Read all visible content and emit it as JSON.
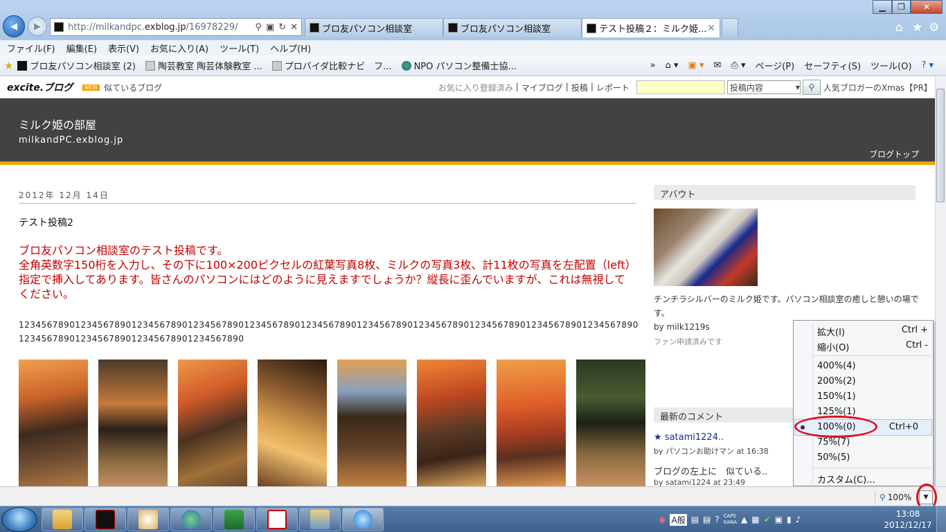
{
  "browser": {
    "address": {
      "prefix": "http://milkandpc.",
      "host": "exblog.jp",
      "path": "/16978229/"
    },
    "tabs": [
      {
        "label": "ブロ友パソコン相談室"
      },
      {
        "label": "ブロ友パソコン相談室"
      },
      {
        "label": "テスト投稿２：ミルク姫..."
      }
    ],
    "menu": [
      "ファイル(F)",
      "編集(E)",
      "表示(V)",
      "お気に入り(A)",
      "ツール(T)",
      "ヘルプ(H)"
    ],
    "favorites": [
      {
        "label": "ブロ友パソコン相談室 (2)"
      },
      {
        "label": "陶芸教室 陶芸体験教室 ..."
      },
      {
        "label": "プロバイダ比較ナビ　フ..."
      },
      {
        "label": "NPO パソコン整備士協..."
      }
    ],
    "commands": {
      "page": "ページ(P)",
      "safety": "セーフティ(S)",
      "tools": "ツール(O)",
      "more": "»"
    }
  },
  "excite": {
    "logo": "excite.ブログ",
    "new_badge": "NEW",
    "similar": "似ているブログ",
    "links": [
      "お気に入り登録済み",
      "|",
      "マイブログ",
      "|",
      "投稿",
      "|",
      "レポート"
    ],
    "select_value": "投稿内容",
    "ad": "人気ブロガーのXmas【PR】"
  },
  "blog": {
    "title": "ミルク姫の部屋",
    "domain": "milkandPC.exblog.jp",
    "top_link": "ブログトップ"
  },
  "post": {
    "date": "2012年 12月 14日",
    "title": "テスト投稿2",
    "body_line1": "ブロ友パソコン相談室のテスト投稿です。",
    "body_line2": "全角英数字150桁を入力し、その下に100×200ピクセルの紅葉写真8枚、ミルクの写真3枚、計11枚の写真を左配置（left）指定で挿入してあります。皆さんのパソコンにはどのように見えますでしょうか？縦長に歪んでいますが、これは無視してください。",
    "digits": "123456789012345678901234567890123456789012345678901234567890123456789012345678901234567890123456789012345678901234567890123456789012345678901234567890"
  },
  "sidebar": {
    "about_head": "アバウト",
    "about_desc": "チンチラシルバーのミルク姫です。パソコン相談室の癒しと憩いの場です。",
    "about_by": "by milk1219s",
    "about_fan": "ファン申請済みです",
    "comments_head": "最新のコメント",
    "comments": [
      {
        "title": "satami1224..",
        "by": "by パソコンお助けマン at 16:38"
      },
      {
        "title": "ブログの左上に　似ている..",
        "by": "by satami1224 at 23:49"
      }
    ]
  },
  "zoom_menu": {
    "items": [
      {
        "label": "拡大(I)",
        "shortcut": "Ctrl +"
      },
      {
        "label": "縮小(O)",
        "shortcut": "Ctrl -"
      },
      {
        "label": "400%(4)"
      },
      {
        "label": "200%(2)"
      },
      {
        "label": "150%(1)"
      },
      {
        "label": "125%(1)"
      },
      {
        "label": "100%(0)",
        "shortcut": "Ctrl+0",
        "selected": true
      },
      {
        "label": "75%(7)"
      },
      {
        "label": "50%(5)"
      },
      {
        "label": "カスタム(C)..."
      }
    ]
  },
  "status": {
    "zoom": "100%"
  },
  "taskbar": {
    "time": "13:08",
    "date": "2012/12/17",
    "ime": "A般",
    "caps": "CAPS",
    "kana": "KANA"
  },
  "colors": {
    "accent_red": "#c40000",
    "header_bg": "#424242",
    "header_border": "#e8a500",
    "circle_red": "#dd1122"
  }
}
